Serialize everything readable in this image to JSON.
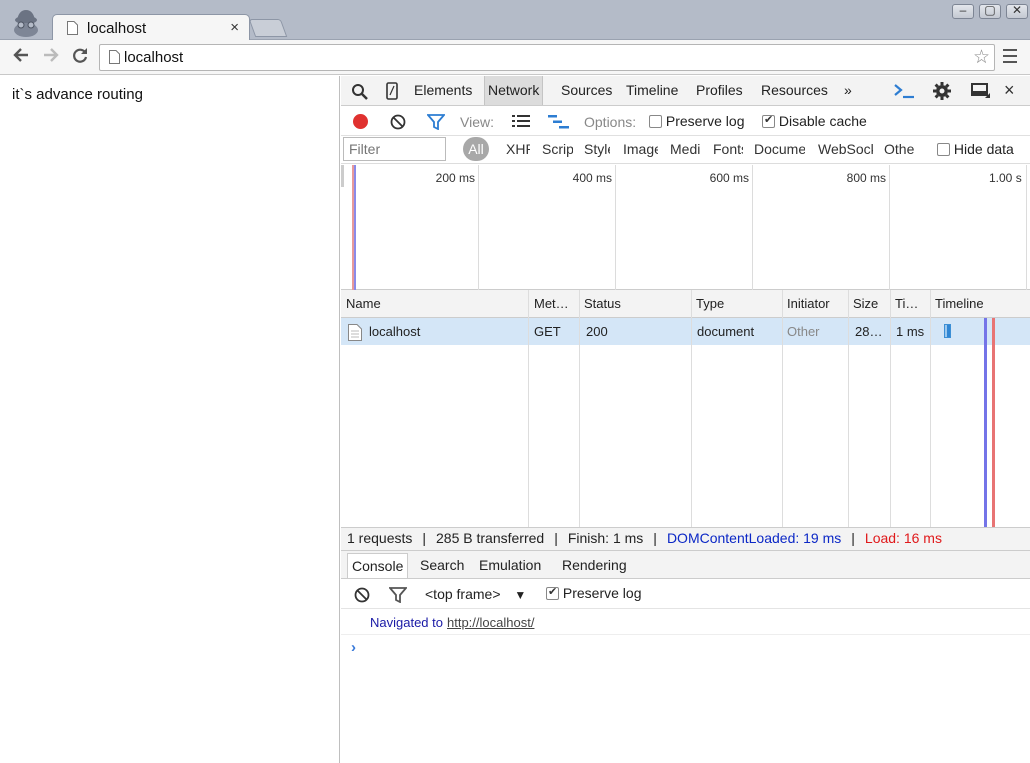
{
  "browser": {
    "tab_title": "localhost",
    "tab_close": "×",
    "url": "localhost",
    "window_buttons": [
      "–",
      "▢",
      "✕"
    ]
  },
  "page": {
    "text": "it`s advance routing"
  },
  "devtools": {
    "tabs": [
      "Elements",
      "Network",
      "Sources",
      "Timeline",
      "Profiles",
      "Resources"
    ],
    "more_tabs": "»",
    "active_tab": "Network",
    "toolbar": {
      "view_label": "View:",
      "options_label": "Options:",
      "preserve_log": "Preserve log",
      "preserve_log_checked": false,
      "disable_cache": "Disable cache",
      "disable_cache_checked": true
    },
    "filter": {
      "placeholder": "Filter",
      "types": [
        "All",
        "XHR",
        "Scripts",
        "Styles",
        "Images",
        "Media",
        "Fonts",
        "Documents",
        "WebSockets",
        "Other"
      ],
      "hide_data": "Hide data"
    },
    "overview_ticks": [
      "200 ms",
      "400 ms",
      "600 ms",
      "800 ms",
      "1.00 s"
    ],
    "table": {
      "columns": [
        "Name",
        "Met…",
        "Status",
        "Type",
        "Initiator",
        "Size",
        "Ti…",
        "Timeline"
      ],
      "rows": [
        {
          "name": "localhost",
          "method": "GET",
          "status": "200",
          "type": "document",
          "initiator": "Other",
          "size": "28…",
          "time": "1 ms"
        }
      ]
    },
    "summary": {
      "requests": "1 requests",
      "transferred": "285 B transferred",
      "finish": "Finish: 1 ms",
      "dom_content_loaded": "DOMContentLoaded: 19 ms",
      "load": "Load: 16 ms",
      "dcl_color": "#0b27c6",
      "load_color": "#e0191b"
    },
    "drawer": {
      "tabs": [
        "Console",
        "Search",
        "Emulation",
        "Rendering"
      ],
      "active_tab": "Console",
      "frame_select": "<top frame>",
      "preserve_log": "Preserve log",
      "preserve_log_checked": true,
      "message_text": "Navigated to",
      "message_link": "http://localhost/",
      "prompt": "›"
    }
  }
}
